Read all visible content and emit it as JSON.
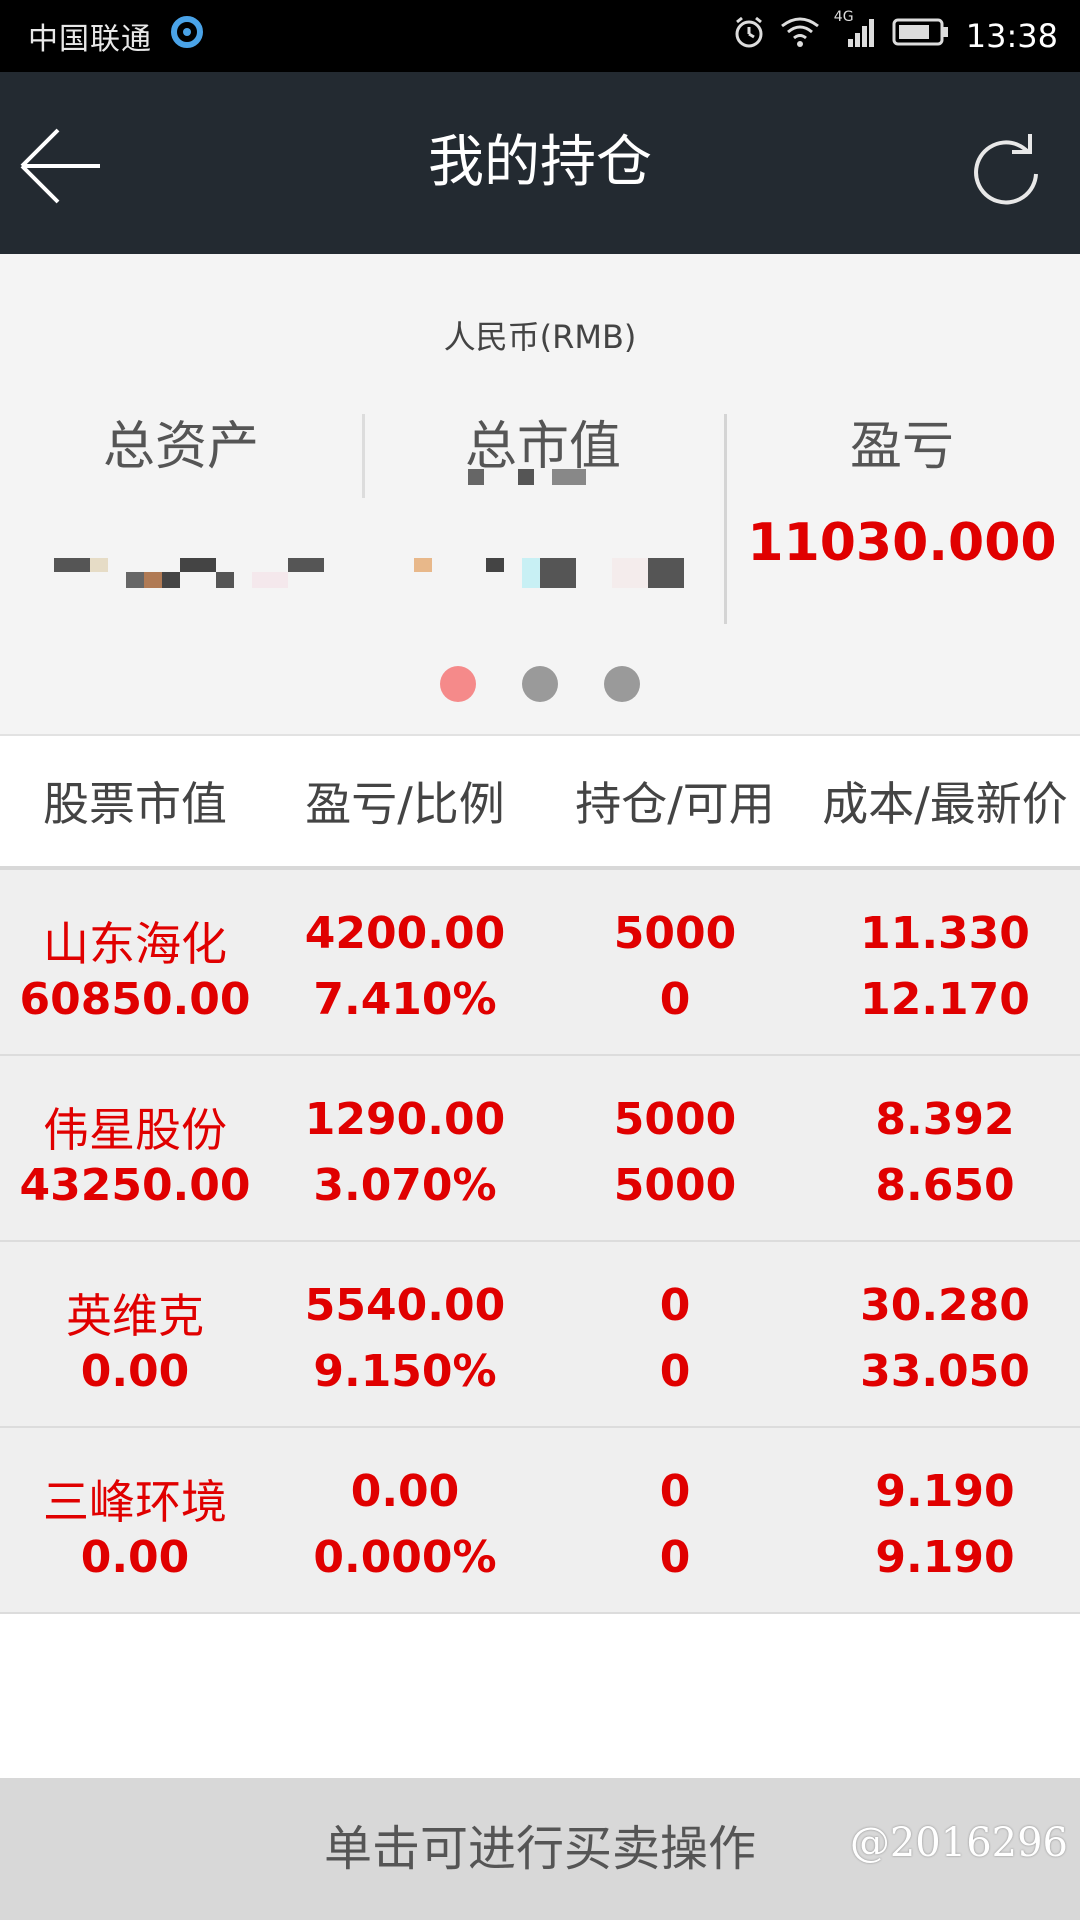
{
  "status_bar": {
    "carrier": "中国联通",
    "network": "4G",
    "time": "13:38"
  },
  "header": {
    "title": "我的持仓"
  },
  "summary": {
    "currency": "人民币(RMB)",
    "total_assets_label": "总资产",
    "market_value_label": "总市值",
    "profit_label": "盈亏",
    "profit_value": "11030.000",
    "page_indicator": {
      "pages": 3,
      "active": 0
    }
  },
  "columns": [
    "股票市值",
    "盈亏/比例",
    "持仓/可用",
    "成本/最新价"
  ],
  "holdings": [
    {
      "name": "山东海化",
      "market_value": "60850.00",
      "profit": "4200.00",
      "ratio": "7.410%",
      "position": "5000",
      "available": "0",
      "cost": "11.330",
      "latest": "12.170"
    },
    {
      "name": "伟星股份",
      "market_value": "43250.00",
      "profit": "1290.00",
      "ratio": "3.070%",
      "position": "5000",
      "available": "5000",
      "cost": "8.392",
      "latest": "8.650"
    },
    {
      "name": "英维克",
      "market_value": "0.00",
      "profit": "5540.00",
      "ratio": "9.150%",
      "position": "0",
      "available": "0",
      "cost": "30.280",
      "latest": "33.050"
    },
    {
      "name": "三峰环境",
      "market_value": "0.00",
      "profit": "0.00",
      "ratio": "0.000%",
      "position": "0",
      "available": "0",
      "cost": "9.190",
      "latest": "9.190"
    }
  ],
  "footer": {
    "hint": "单击可进行买卖操作",
    "watermark": "@2016296"
  },
  "colors": {
    "header_bg": "#232a31",
    "accent_red": "#e00000",
    "row_bg": "#efefef",
    "active_dot": "#f58a8a"
  }
}
